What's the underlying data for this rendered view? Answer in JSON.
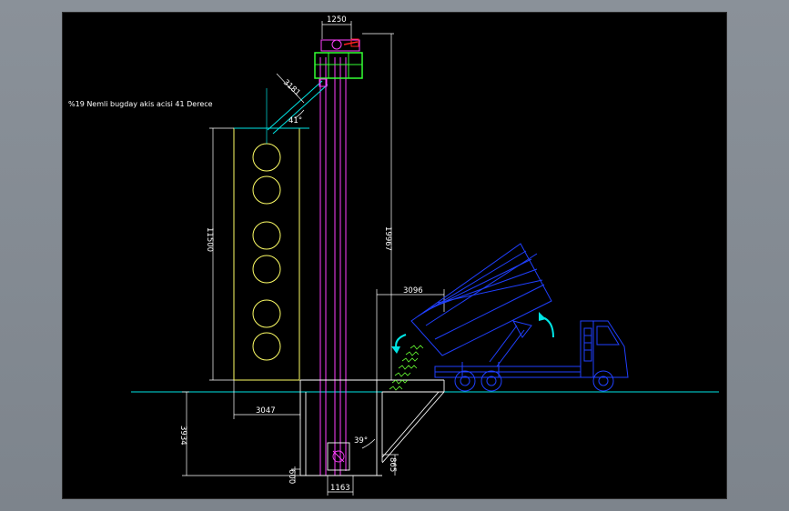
{
  "note": "%19 Nemli bugday akis acisi 41 Derece",
  "dimensions": {
    "top_width": "1250",
    "silo_height": "11500",
    "total_height": "19967",
    "truck_offset": "3096",
    "silo_offset": "3047",
    "pit_depth": "3934",
    "pit_bottom": "600",
    "pit_width": "1163",
    "hopper_height": "865",
    "spout_length": "3181"
  },
  "angles": {
    "spout_angle": "41°",
    "hopper_angle": "39°"
  },
  "colors": {
    "background": "#000000",
    "ground": "#00e5e5",
    "silo": "#ffff66",
    "elevator": "#ff40ff",
    "truck": "#2040ff",
    "grain": "#66ff33",
    "head": "#33ff33",
    "dimension": "#ffffff"
  }
}
